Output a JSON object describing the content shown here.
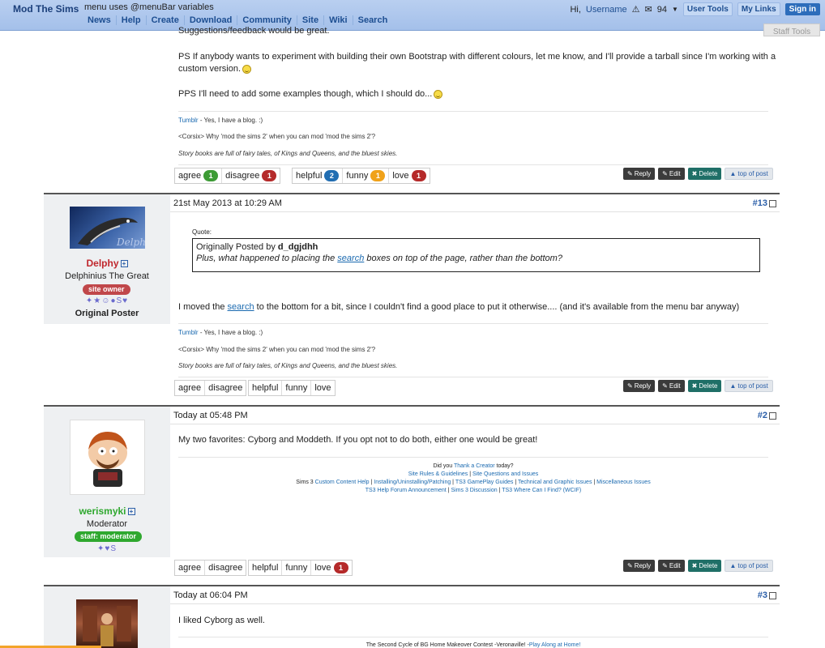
{
  "header": {
    "brand": "Mod The Sims",
    "subtitle": "menu uses @menuBar variables",
    "nav": [
      "News",
      "Help",
      "Create",
      "Download",
      "Community",
      "Site",
      "Wiki",
      "Search"
    ],
    "greeting": "Hi,",
    "username": "Username",
    "notif_count": "94",
    "user_tools": "User Tools",
    "my_links": "My Links",
    "sign_in": "Sign in"
  },
  "staff_tools": "Staff Tools",
  "post1": {
    "line_top": "Suggestions/feedback would be great.",
    "ps": "PS If anybody wants to experiment with building their own Bootstrap with different colours, let me know, and I'll provide a tarball since I'm working with a custom version.",
    "pps": "PPS I'll need to add some examples though, which I should do...",
    "reactions": [
      {
        "label": "agree",
        "count": "1",
        "color": "#3d9b35"
      },
      {
        "label": "disagree",
        "count": "1",
        "color": "#b52a2a"
      }
    ],
    "reactions2": [
      {
        "label": "helpful",
        "count": "2",
        "color": "#226eb2"
      },
      {
        "label": "funny",
        "count": "1",
        "color": "#f0a21a"
      },
      {
        "label": "love",
        "count": "1",
        "color": "#b52a2a"
      }
    ]
  },
  "signature_delphy": {
    "tumblr": "Tumblr",
    "tumblr_rest": " - Yes, I have a blog. :)",
    "corsix": "<Corsix> Why 'mod the sims 2' when you can mod 'mod the sims 2'?",
    "story": "Story books are full of fairy tales, of Kings and Queens, and the bluest skies."
  },
  "actions": {
    "reply": "Reply",
    "edit": "Edit",
    "delete": "Delete",
    "top": "top of post"
  },
  "post13": {
    "date": "21st May 2013 at 10:29 AM",
    "number": "#13",
    "user": "Delphy",
    "user_title": "Delphinius The Great",
    "badge": "site owner",
    "original_poster": "Original Poster",
    "quote_label": "Quote:",
    "quote_by_prefix": "Originally Posted by ",
    "quote_author": "d_dgjdhh",
    "quote_pre": "Plus, what happened to placing the ",
    "quote_link": "search",
    "quote_post": " boxes on top of the page, rather than the bottom?",
    "body_pre": "I moved the ",
    "body_link": "search",
    "body_post": " to the bottom for a bit, since I couldn't find a good place to put it otherwise.... (and it's available from the menu bar anyway)",
    "reactions": [
      "agree",
      "disagree"
    ],
    "reactions2": [
      "helpful",
      "funny",
      "love"
    ]
  },
  "post2": {
    "date": "Today at 05:48 PM",
    "number": "#2",
    "user": "werismyki",
    "user_title": "Moderator",
    "badge": "staff: moderator",
    "body": "My two favorites: Cyborg and Moddeth. If you opt not to do both, either one would be great!",
    "sig_line1_pre": "Did you ",
    "sig_line1_link": "Thank a Creator",
    "sig_line1_post": " today?",
    "sig_line2": [
      "Site Rules & Guidelines",
      "Site Questions and Issues"
    ],
    "sig_line3_prefix": "Sims 3 ",
    "sig_line3": [
      "Custom Content Help",
      "Installing/Uninstalling/Patching",
      "TS3 GamePlay Guides",
      "Technical and Graphic Issues",
      "Miscellaneous Issues"
    ],
    "sig_line4": [
      "TS3 Help Forum Announcement",
      "Sims 3 Discussion",
      "TS3 Where Can I Find? (WCIF)"
    ],
    "reactions": [
      "agree",
      "disagree"
    ],
    "reactions2": [
      {
        "label": "helpful"
      },
      {
        "label": "funny"
      },
      {
        "label": "love",
        "count": "1"
      }
    ]
  },
  "post3": {
    "date": "Today at 06:04 PM",
    "number": "#3",
    "body": "I liked Cyborg as well.",
    "sig_pre": "The Second Cycle of BG Home Makeover Contest -Veronaville! -",
    "sig_link": "Play Along at Home!"
  },
  "colors": {
    "topbar": "#a4c0ea",
    "link": "#1b6ab0",
    "site_owner": "#c0474a",
    "moderator": "#2fa82f",
    "delphy_name": "#c0272d",
    "werismyki_name": "#2fa82f"
  }
}
